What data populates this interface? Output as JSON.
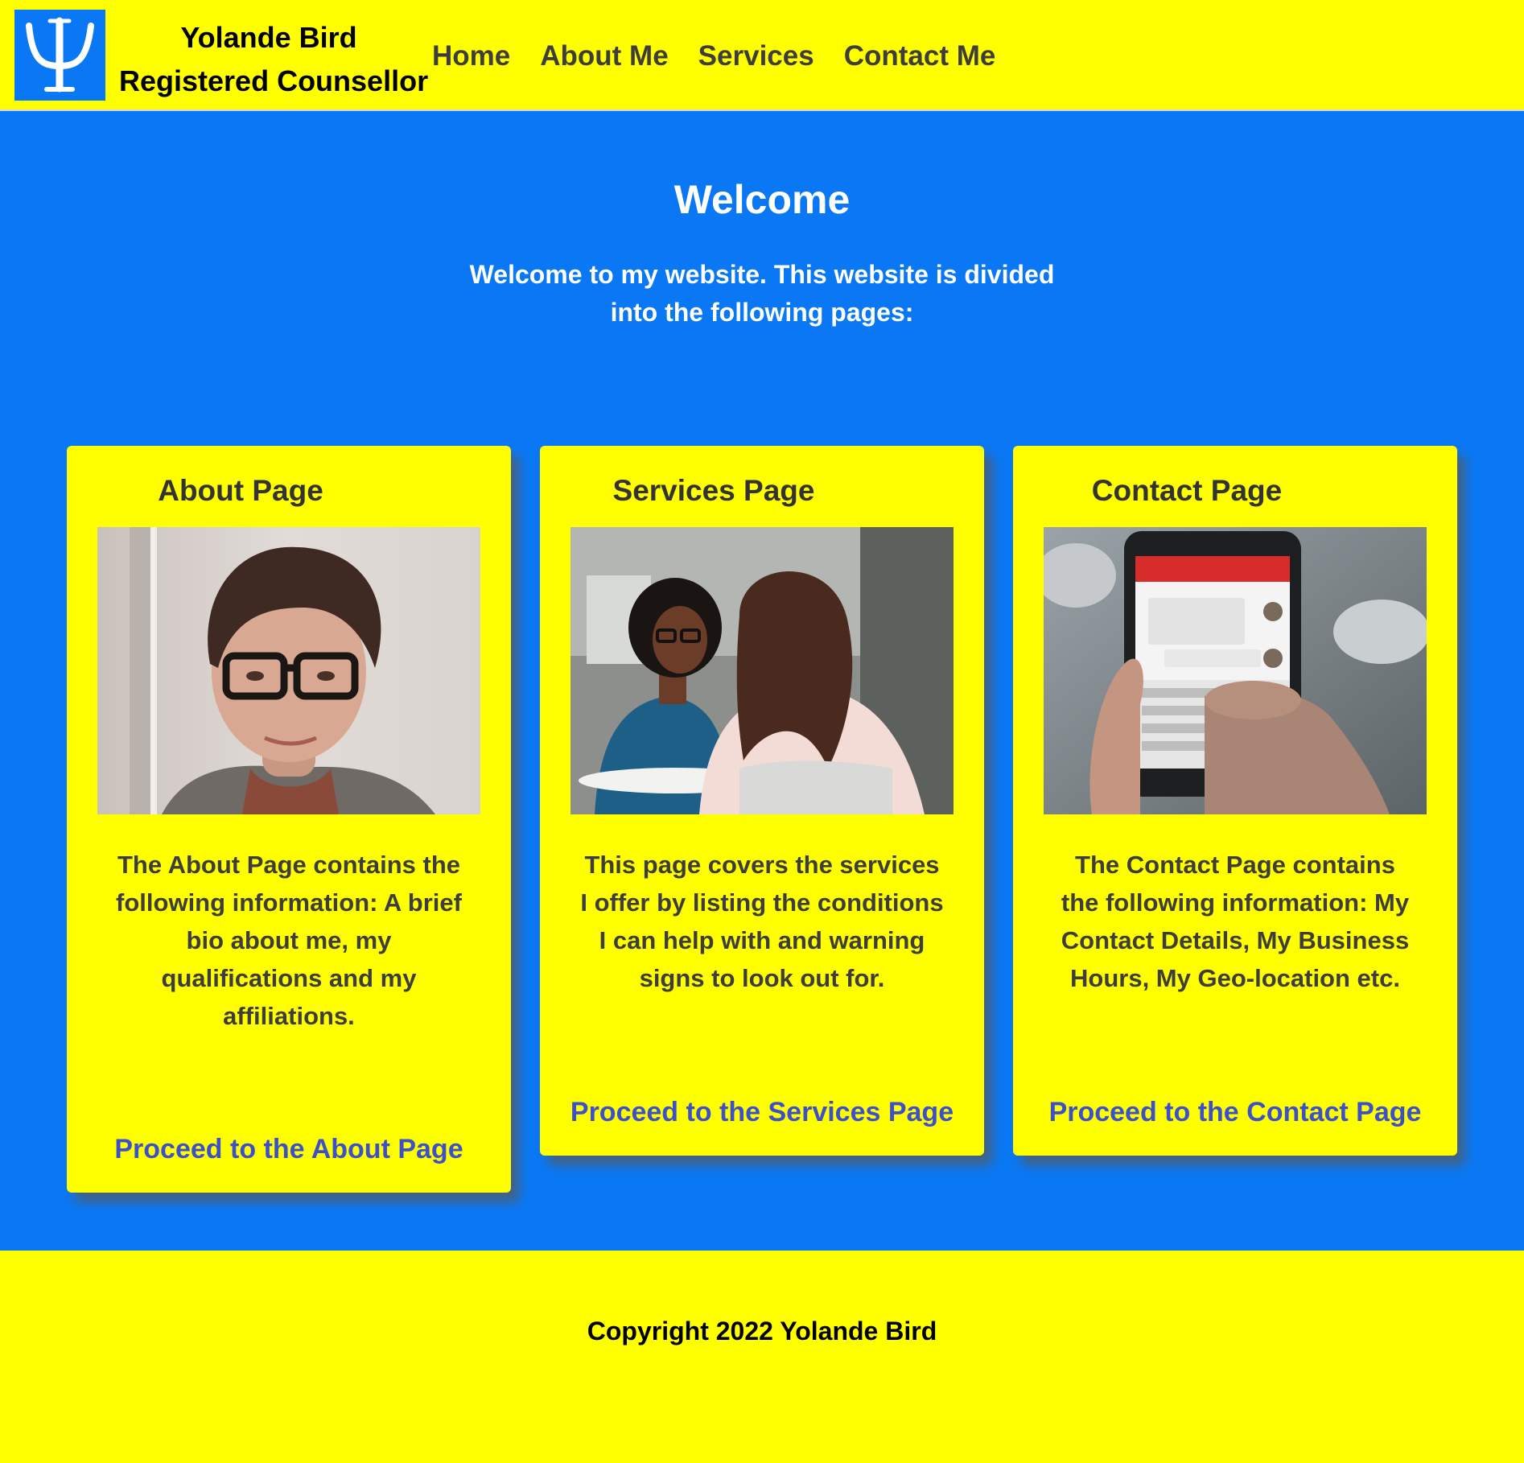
{
  "header": {
    "name": "Yolande Bird",
    "title": "Registered Counsellor",
    "logo_glyph": "psi-symbol",
    "nav": [
      {
        "label": "Home"
      },
      {
        "label": "About Me"
      },
      {
        "label": "Services"
      },
      {
        "label": "Contact Me"
      }
    ]
  },
  "welcome": {
    "heading": "Welcome",
    "intro": "Welcome to my website. This website is divided into the following pages:"
  },
  "cards": [
    {
      "title": "About Page",
      "image": "portrait-photo",
      "text": "The About Page contains the following information: A brief bio about me, my qualifications and my affiliations.",
      "link": "Proceed to the About Page"
    },
    {
      "title": "Services Page",
      "image": "counselling-session-photo",
      "text": "This page covers the services I offer by listing the conditions I can help with and warning signs to look out for.",
      "link": "Proceed to the Services Page"
    },
    {
      "title": "Contact Page",
      "image": "phone-messaging-photo",
      "text": "The Contact Page contains the following information: My Contact Details, My Business Hours, My Geo-location etc.",
      "link": "Proceed to the Contact Page"
    }
  ],
  "footer": {
    "copyright": "Copyright 2022 Yolande Bird"
  },
  "colors": {
    "header_bg": "#ffff00",
    "main_bg": "#0a78f5",
    "card_bg": "#ffff00",
    "link": "#3d50cc",
    "nav_text": "#3d3d3d"
  }
}
